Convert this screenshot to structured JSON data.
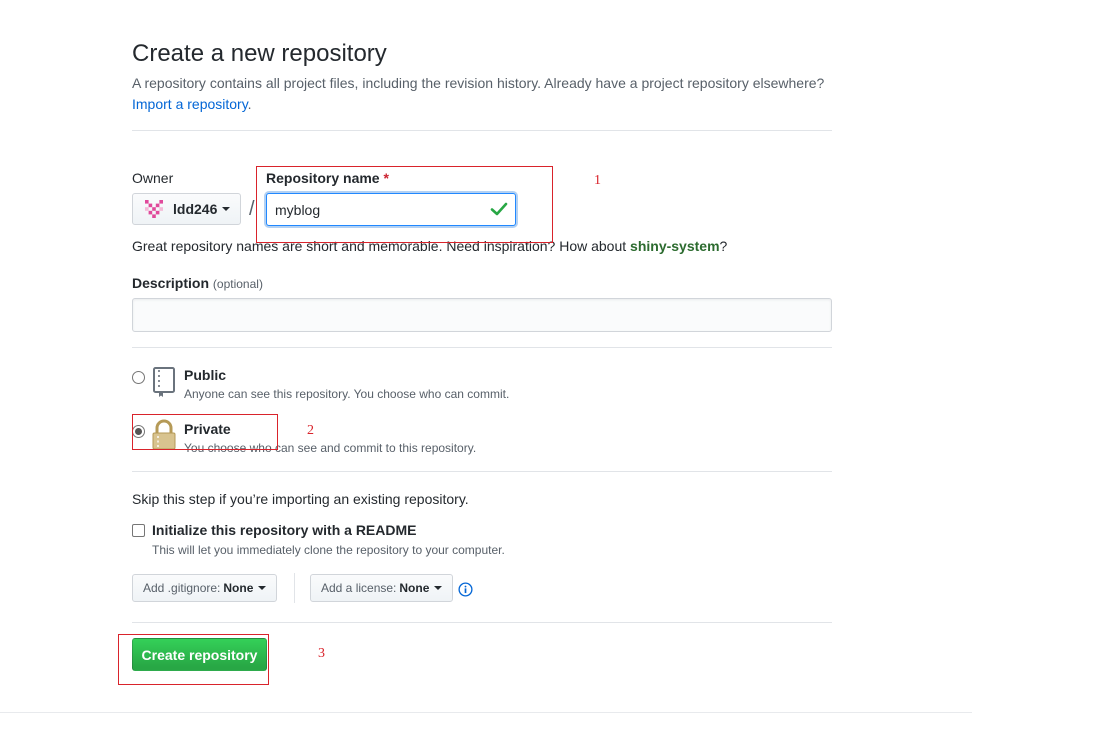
{
  "header": {
    "title": "Create a new repository",
    "subtitle": "A repository contains all project files, including the revision history. Already have a project repository elsewhere?",
    "import_link": "Import a repository",
    "import_suffix": "."
  },
  "owner": {
    "label": "Owner",
    "value": "ldd246",
    "avatar_color": "#e0499b"
  },
  "repo_name": {
    "label": "Repository name",
    "required_mark": "*",
    "separator": "/",
    "value": "myblog",
    "valid_color": "#28a745"
  },
  "hint": {
    "prefix": "Great repository names are short and memorable. Need inspiration? How about",
    "suggestion": "shiny-system",
    "suffix": "?"
  },
  "description": {
    "label": "Description",
    "optional": "(optional)",
    "value": ""
  },
  "visibility": {
    "public": {
      "title": "Public",
      "note": "Anyone can see this repository. You choose who can commit.",
      "selected": false
    },
    "private": {
      "title": "Private",
      "note": "You choose who can see and commit to this repository.",
      "selected": true
    }
  },
  "init": {
    "skip_note": "Skip this step if you’re importing an existing repository.",
    "readme_label": "Initialize this repository with a README",
    "readme_note": "This will let you immediately clone the repository to your computer.",
    "readme_checked": false
  },
  "gitignore": {
    "label": "Add .gitignore:",
    "value": "None"
  },
  "license": {
    "label": "Add a license:",
    "value": "None"
  },
  "submit": {
    "label": "Create repository",
    "color": "#28a745"
  },
  "annotations": {
    "one": "1",
    "two": "2",
    "three": "3",
    "color": "#d9232b"
  }
}
